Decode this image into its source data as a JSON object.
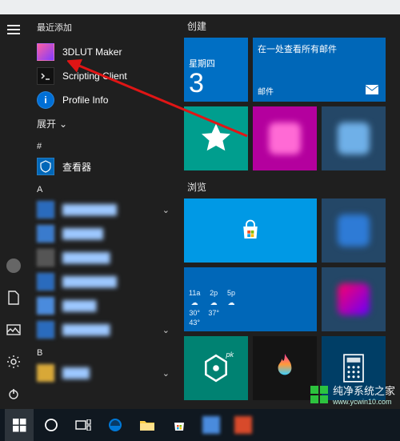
{
  "applist": {
    "recent_header": "最近添加",
    "items": [
      {
        "label": "3DLUT Maker"
      },
      {
        "label": "Scripting Client"
      },
      {
        "label": "Profile Info"
      }
    ],
    "expand": "展开",
    "letter_hash": "#",
    "viewer_label": "查看器",
    "letter_a": "A",
    "a_items": [
      "—",
      "—",
      "—",
      "—",
      "—",
      "—"
    ],
    "letter_b": "B",
    "b_items": [
      "—"
    ]
  },
  "tiles": {
    "group_create": "创建",
    "group_browse": "浏览",
    "calendar": {
      "dow": "星期四",
      "day": "3"
    },
    "mail": {
      "title": "在一处查看所有邮件",
      "label": "邮件"
    },
    "weather": {
      "cols": [
        {
          "t": "11a",
          "hi": "30°",
          "lo": "43°"
        },
        {
          "t": "2p",
          "hi": "37°",
          "lo": ""
        },
        {
          "t": "5p",
          "hi": "",
          "lo": ""
        }
      ]
    }
  },
  "watermark": {
    "cn": "纯净系统之家",
    "dom": "www.ycwin10.com"
  }
}
